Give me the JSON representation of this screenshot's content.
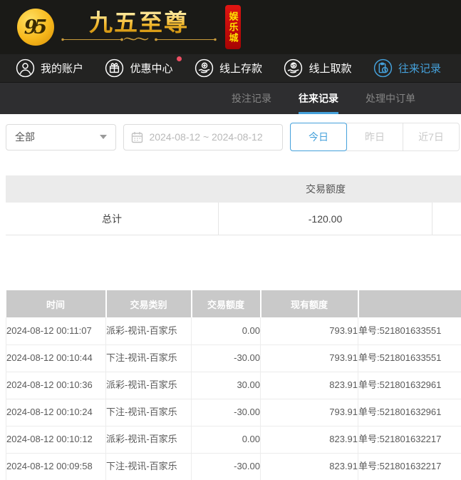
{
  "brand": {
    "monogram": "95",
    "name": "九五至尊",
    "badge": "娱乐城"
  },
  "nav": {
    "items": [
      {
        "label": "我的账户",
        "icon": "user-icon",
        "active": false,
        "dot": false
      },
      {
        "label": "优惠中心",
        "icon": "gift-icon",
        "active": false,
        "dot": true
      },
      {
        "label": "线上存款",
        "icon": "deposit-icon",
        "active": false,
        "dot": false
      },
      {
        "label": "线上取款",
        "icon": "withdraw-icon",
        "active": false,
        "dot": false
      },
      {
        "label": "往来记录",
        "icon": "records-icon",
        "active": true,
        "dot": false
      }
    ]
  },
  "subnav": {
    "tabs": [
      {
        "label": "投注记录",
        "active": false
      },
      {
        "label": "往来记录",
        "active": true
      },
      {
        "label": "处理中订单",
        "active": false
      }
    ]
  },
  "filters": {
    "category_value": "全部",
    "date_range": "2024-08-12 ~ 2024-08-12",
    "quick_buttons": [
      {
        "label": "今日",
        "active": true
      },
      {
        "label": "昨日",
        "active": false
      },
      {
        "label": "近7日",
        "active": false
      }
    ]
  },
  "summary": {
    "amount_header": "交易额度",
    "total_label": "总计",
    "total_value": "-120.00"
  },
  "table": {
    "headers": [
      "时间",
      "交易类别",
      "交易额度",
      "现有额度",
      ""
    ],
    "rows": [
      {
        "time": "2024-08-12 00:11:07",
        "type": "派彩-视讯-百家乐",
        "amount": "0.00",
        "balance": "793.91",
        "order": "单号:521801633551"
      },
      {
        "time": "2024-08-12 00:10:44",
        "type": "下注-视讯-百家乐",
        "amount": "-30.00",
        "balance": "793.91",
        "order": "单号:521801633551"
      },
      {
        "time": "2024-08-12 00:10:36",
        "type": "派彩-视讯-百家乐",
        "amount": "30.00",
        "balance": "823.91",
        "order": "单号:521801632961"
      },
      {
        "time": "2024-08-12 00:10:24",
        "type": "下注-视讯-百家乐",
        "amount": "-30.00",
        "balance": "793.91",
        "order": "单号:521801632961"
      },
      {
        "time": "2024-08-12 00:10:12",
        "type": "派彩-视讯-百家乐",
        "amount": "0.00",
        "balance": "823.91",
        "order": "单号:521801632217"
      },
      {
        "time": "2024-08-12 00:09:58",
        "type": "下注-视讯-百家乐",
        "amount": "-30.00",
        "balance": "823.91",
        "order": "单号:521801632217"
      }
    ]
  },
  "colors": {
    "accent_blue": "#45a1db",
    "badge_dot_red": "#ee4f63",
    "logo_gold": "#f3b92e",
    "logo_badge_red": "#c40e12",
    "table_header_gray": "#c9c9c9"
  }
}
